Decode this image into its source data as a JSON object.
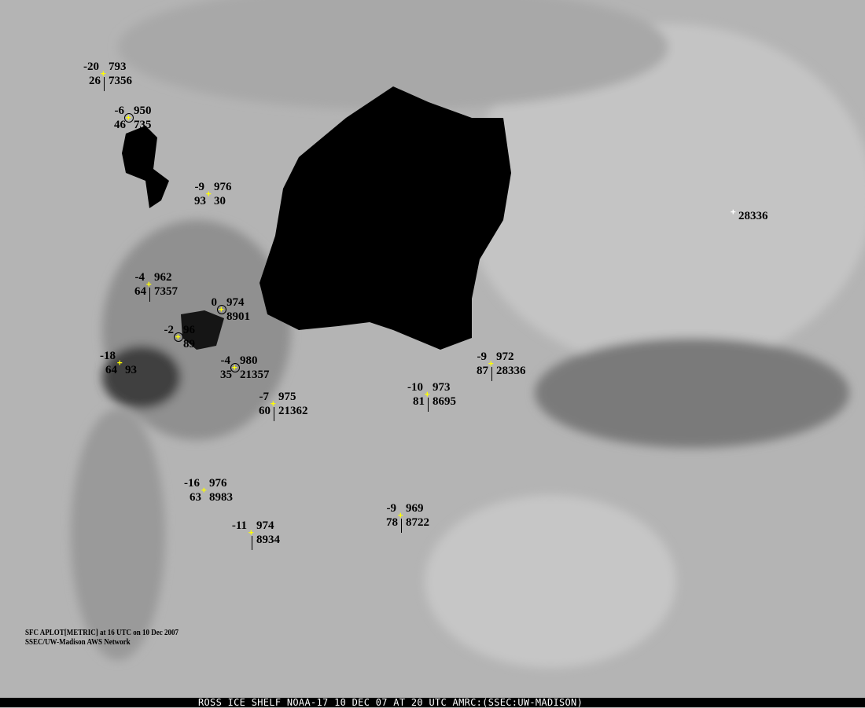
{
  "legend": {
    "line1": "SFC APLOT[METRIC] at 16 UTC on 10 Dec 2007",
    "line2": "SSEC/UW-Madison AWS Network"
  },
  "footer": {
    "caption": "ROSS ICE SHELF NOAA-17 10 DEC 07 AT 20 UTC AMRC:(SSEC:UW-MADISON)"
  },
  "colors": {
    "marker": "#ffff00",
    "text": "#000000",
    "open_water": "#000000",
    "ice": "#b2b2b2"
  },
  "stations": [
    {
      "temp": "-20",
      "pressure": "793",
      "humidity": "26",
      "id": "7356"
    },
    {
      "temp": "-6",
      "pressure": "950",
      "humidity": "46",
      "id": "735"
    },
    {
      "temp": "-9",
      "pressure": "976",
      "humidity": "93",
      "id": "30"
    },
    {
      "temp": "-4",
      "pressure": "962",
      "humidity": "64",
      "id": "7357"
    },
    {
      "temp": "0",
      "pressure": "974",
      "humidity": "",
      "id": "8901"
    },
    {
      "temp": "-2",
      "pressure": "96",
      "humidity": "",
      "id": "89"
    },
    {
      "temp": "-18",
      "pressure": "",
      "humidity": "64",
      "id": "93"
    },
    {
      "temp": "-4",
      "pressure": "980",
      "humidity": "35",
      "id": "21357"
    },
    {
      "temp": "-7",
      "pressure": "975",
      "humidity": "60",
      "id": "21362"
    },
    {
      "temp": "-10",
      "pressure": "973",
      "humidity": "81",
      "id": "8695"
    },
    {
      "temp": "-9",
      "pressure": "972",
      "humidity": "87",
      "id": "28336"
    },
    {
      "temp": "-16",
      "pressure": "976",
      "humidity": "63",
      "id": "8983"
    },
    {
      "temp": "-11",
      "pressure": "974",
      "humidity": "",
      "id": "8934"
    },
    {
      "temp": "-9",
      "pressure": "969",
      "humidity": "78",
      "id": "8722"
    },
    {
      "temp": "",
      "pressure": "",
      "humidity": "",
      "id": "28336"
    }
  ]
}
